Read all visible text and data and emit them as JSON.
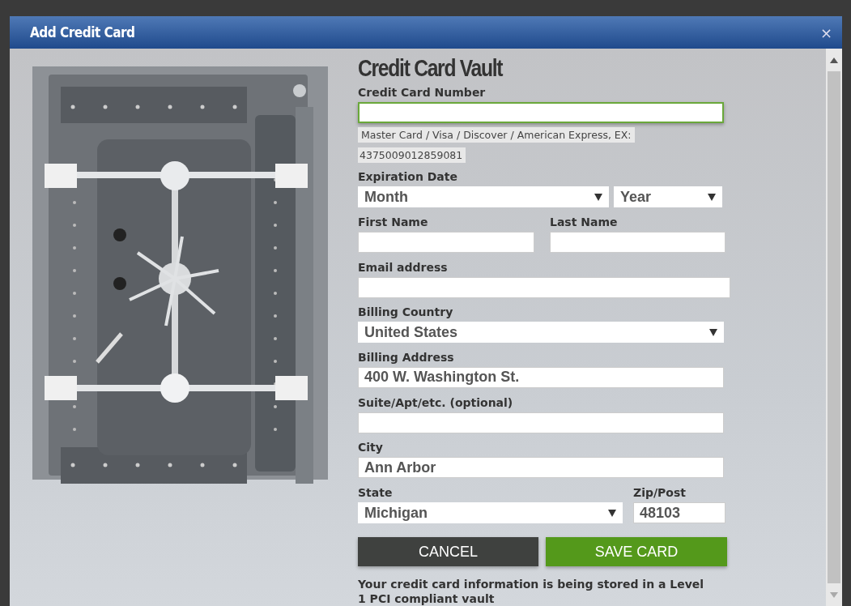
{
  "dialog": {
    "title": "Add Credit Card",
    "close": "×"
  },
  "heading": "Credit Card Vault",
  "card_number": {
    "label": "Credit Card Number",
    "focused": true,
    "hints": [
      "Master Card / Visa / Discover / American Express, EX:",
      "4375009012859081"
    ]
  },
  "expiration": {
    "label": "Expiration Date",
    "month": "Month",
    "year": "Year"
  },
  "first_name": {
    "label": "First Name"
  },
  "last_name": {
    "label": "Last Name"
  },
  "email": {
    "label": "Email address"
  },
  "billing_country": {
    "label": "Billing Country",
    "value": "United States"
  },
  "billing_address": {
    "label": "Billing Address",
    "value": "400 W. Washington St."
  },
  "suite": {
    "label": "Suite/Apt/etc. (optional)"
  },
  "city": {
    "label": "City",
    "value": "Ann Arbor"
  },
  "state": {
    "label": "State",
    "value": "Michigan"
  },
  "zip": {
    "label": "Zip/Post",
    "value": "48103"
  },
  "buttons": [
    {
      "label": "CANCEL",
      "kind": "secondary"
    },
    {
      "label": "SAVE CARD",
      "kind": "primary"
    }
  ],
  "notice": "Your credit card information is being stored in a Level 1 PCI compliant vault"
}
